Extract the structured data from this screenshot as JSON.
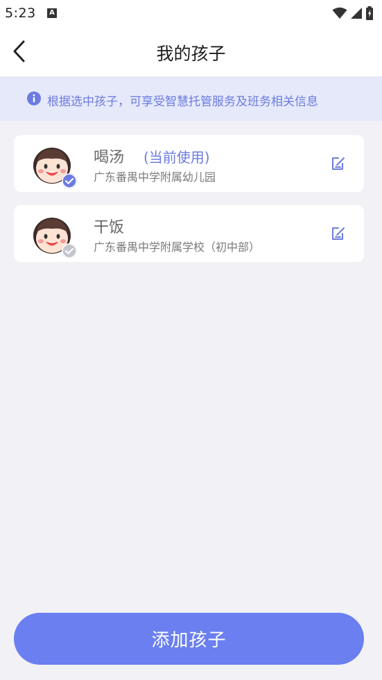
{
  "status_bar": {
    "time": "5:23",
    "notification_icon": "A"
  },
  "header": {
    "title": "我的孩子"
  },
  "notice": {
    "text": "根据选中孩子，可享受智慧托管服务及班务相关信息"
  },
  "children": [
    {
      "name": "喝汤",
      "tag": "(当前使用)",
      "school": "广东番禺中学附属幼儿园",
      "selected": true
    },
    {
      "name": "干饭",
      "tag": "",
      "school": "广东番禺中学附属学校（初中部）",
      "selected": false
    }
  ],
  "actions": {
    "add_child_label": "添加孩子"
  },
  "colors": {
    "accent": "#6b7be0",
    "button": "#6b7ff0",
    "notice_bg": "#e6e9fa",
    "page_bg": "#f2f2f6",
    "unselected_badge": "#c4c6cc"
  }
}
